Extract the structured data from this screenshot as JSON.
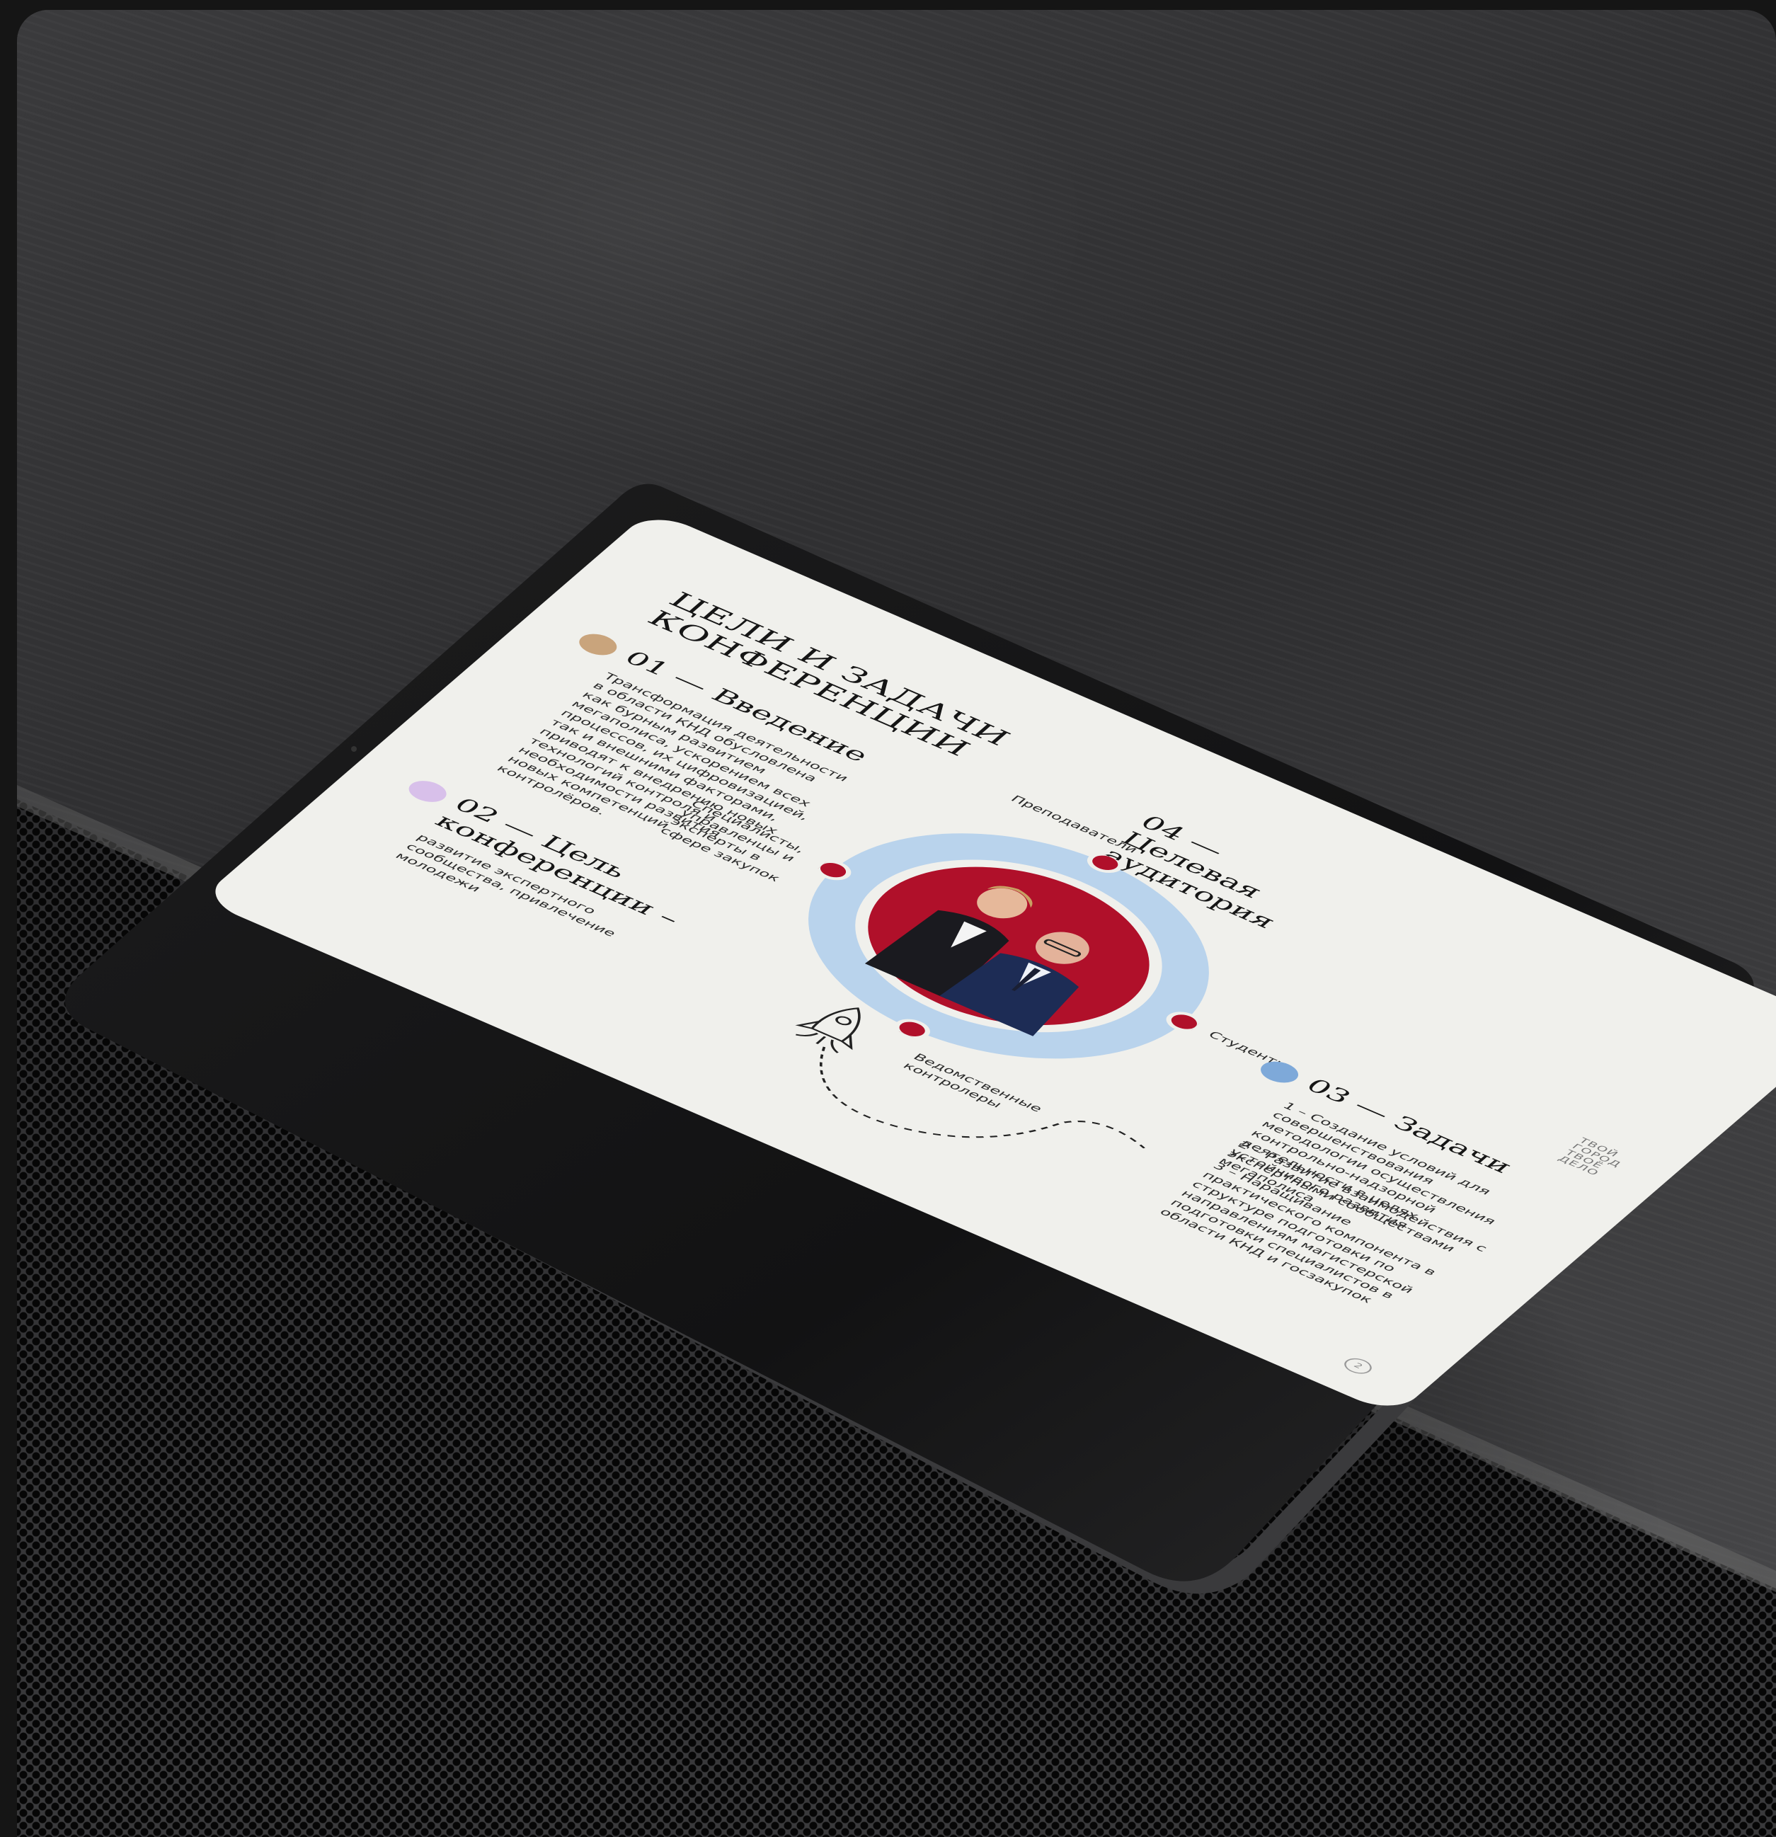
{
  "slide": {
    "title": "ЦЕЛИ И ЗАДАЧИ КОНФЕРЕНЦИИ",
    "section1": {
      "heading": "01 — Введение",
      "text": "Трансформация деятельности в области КНД обусловлена как бурным развитием мегаполиса, ускорением всех процессов, их цифровизацией, так и внешними факторами, приводят к внедрению новых технологий контроля и необходимости развития новых компетенций контролёров."
    },
    "section2": {
      "heading": "02 — Цель конференции –",
      "text": "развитие экспертного сообщества, привлечение молодежи"
    },
    "section3": {
      "heading": "03 — Задачи",
      "items": [
        "1 – Создание условий для совершенствования методологии осуществления контрольно-надзорной деятельности в целях устойчивого развития мегаполиса",
        "2 – Развитие взаимодействия с экспертными сообществами",
        "3 – Наращивание практического компонента в структуре подготовки по направлениям магистерской подготовки специалистов в области КНД и госзакупок"
      ]
    },
    "section4": {
      "heading": "04 —Целевая аудитория",
      "audience": [
        "Преподаватели",
        "Студенты",
        "Ведомственные контролеры",
        "Специалисты, управленцы и эксперты в сфере закупок"
      ]
    },
    "logo_text": [
      "ТВОЙ",
      "ГОРОД",
      "ТВОЁ",
      "ДЕЛО"
    ],
    "page_number": "2"
  },
  "colors": {
    "accent_red": "#b0102a",
    "ring_blue": "#b9d3ec",
    "dot_gold": "#c9a47c",
    "dot_lilac": "#d8c0ea",
    "dot_blue": "#7ea9d9",
    "screen_bg": "#f0f0ec"
  },
  "icons": [
    "rocket-icon"
  ]
}
